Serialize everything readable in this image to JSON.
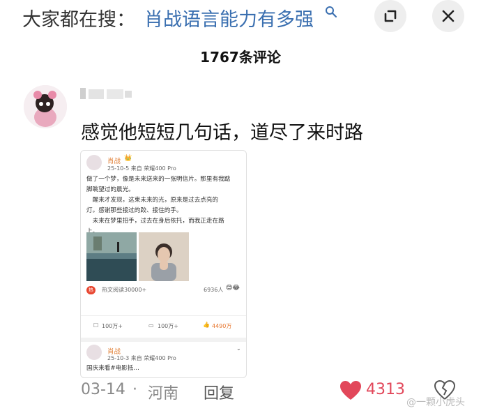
{
  "search": {
    "prefix": "大家都在搜：",
    "query": "肖战语言能力有多强"
  },
  "comments": {
    "count_label": "1767条评论"
  },
  "comment": {
    "text": "感觉他短短几句话，道尽了来时路",
    "date": "03-14",
    "separator": "·",
    "location": "河南",
    "reply_label": "回复",
    "like_count": "4313"
  },
  "embedded_post": {
    "author": "肖战",
    "meta": "25-10-5  来自 荣耀400 Pro",
    "body_lines": [
      "做了一个梦，像是未来送来的一张明信片。那里有我踮",
      "脚眺望过的晨光。",
      "　醒来才发现，这束未来的光，原来是过去点亮的",
      "灯。感谢那些接过的跤、接住的手。",
      "　未来在梦里招手，过去在身后依托，而我正走在路",
      "上。"
    ],
    "hot_badge": "热",
    "hot_text": "热文阅读30000+",
    "reactions": "6936人",
    "actions": {
      "repost": "100万+",
      "comment": "100万+",
      "like": "4490万"
    }
  },
  "embedded_post_2": {
    "author": "肖战",
    "meta": "25-10-3  来自 荣耀400 Pro",
    "body": "国庆来看#电影抵…"
  },
  "watermark": "@一颗小虎头",
  "colors": {
    "link_blue": "#3a6fb0",
    "like_red": "#e2475a",
    "author_orange": "#e07b2f"
  }
}
